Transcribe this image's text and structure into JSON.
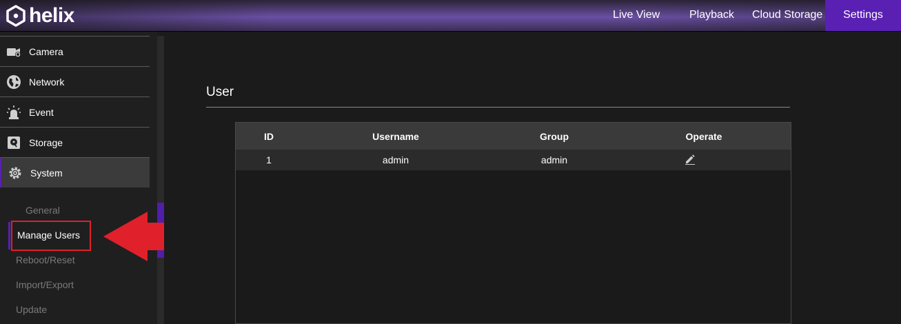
{
  "app": {
    "logo_text": "helix"
  },
  "nav": {
    "live_view": "Live View",
    "playback": "Playback",
    "cloud_storage": "Cloud Storage",
    "settings": "Settings",
    "active": "Settings"
  },
  "sidebar": {
    "items": [
      {
        "label": "Camera",
        "icon": "camera-icon"
      },
      {
        "label": "Network",
        "icon": "globe-icon"
      },
      {
        "label": "Event",
        "icon": "alarm-icon"
      },
      {
        "label": "Storage",
        "icon": "storage-icon"
      },
      {
        "label": "System",
        "icon": "gear-icon"
      }
    ],
    "active": "System",
    "subitems": [
      {
        "label": "General"
      },
      {
        "label": "Manage Users"
      },
      {
        "label": "Reboot/Reset"
      },
      {
        "label": "Import/Export"
      },
      {
        "label": "Update"
      }
    ],
    "selected_subitem": "Manage Users"
  },
  "main": {
    "title": "User",
    "table": {
      "headers": {
        "id": "ID",
        "username": "Username",
        "group": "Group",
        "operate": "Operate"
      },
      "rows": [
        {
          "id": "1",
          "username": "admin",
          "group": "admin",
          "operate_icon": "edit-icon"
        }
      ]
    }
  },
  "colors": {
    "accent": "#5a1fb3",
    "annotation": "#e0202a"
  }
}
